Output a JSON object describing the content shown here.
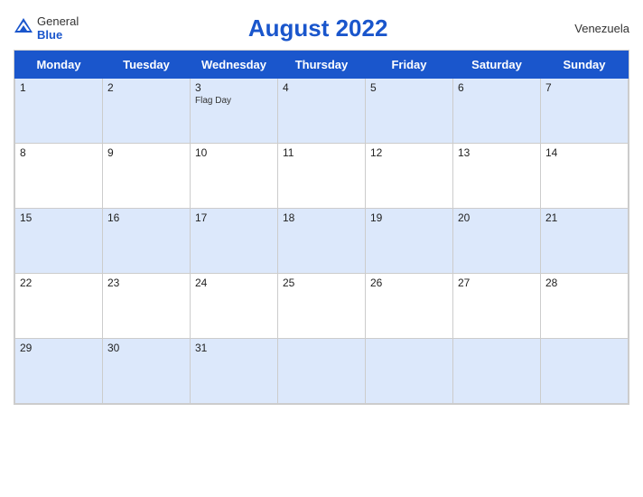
{
  "header": {
    "logo": {
      "general": "General",
      "blue": "Blue",
      "icon": "▲"
    },
    "title": "August 2022",
    "country": "Venezuela"
  },
  "weekdays": [
    "Monday",
    "Tuesday",
    "Wednesday",
    "Thursday",
    "Friday",
    "Saturday",
    "Sunday"
  ],
  "weeks": [
    [
      {
        "day": "1",
        "holiday": ""
      },
      {
        "day": "2",
        "holiday": ""
      },
      {
        "day": "3",
        "holiday": "Flag Day"
      },
      {
        "day": "4",
        "holiday": ""
      },
      {
        "day": "5",
        "holiday": ""
      },
      {
        "day": "6",
        "holiday": ""
      },
      {
        "day": "7",
        "holiday": ""
      }
    ],
    [
      {
        "day": "8",
        "holiday": ""
      },
      {
        "day": "9",
        "holiday": ""
      },
      {
        "day": "10",
        "holiday": ""
      },
      {
        "day": "11",
        "holiday": ""
      },
      {
        "day": "12",
        "holiday": ""
      },
      {
        "day": "13",
        "holiday": ""
      },
      {
        "day": "14",
        "holiday": ""
      }
    ],
    [
      {
        "day": "15",
        "holiday": ""
      },
      {
        "day": "16",
        "holiday": ""
      },
      {
        "day": "17",
        "holiday": ""
      },
      {
        "day": "18",
        "holiday": ""
      },
      {
        "day": "19",
        "holiday": ""
      },
      {
        "day": "20",
        "holiday": ""
      },
      {
        "day": "21",
        "holiday": ""
      }
    ],
    [
      {
        "day": "22",
        "holiday": ""
      },
      {
        "day": "23",
        "holiday": ""
      },
      {
        "day": "24",
        "holiday": ""
      },
      {
        "day": "25",
        "holiday": ""
      },
      {
        "day": "26",
        "holiday": ""
      },
      {
        "day": "27",
        "holiday": ""
      },
      {
        "day": "28",
        "holiday": ""
      }
    ],
    [
      {
        "day": "29",
        "holiday": ""
      },
      {
        "day": "30",
        "holiday": ""
      },
      {
        "day": "31",
        "holiday": ""
      },
      {
        "day": "",
        "holiday": ""
      },
      {
        "day": "",
        "holiday": ""
      },
      {
        "day": "",
        "holiday": ""
      },
      {
        "day": "",
        "holiday": ""
      }
    ]
  ],
  "colors": {
    "header_bg": "#1a56cc",
    "odd_row_bg": "#dce8fb",
    "even_row_bg": "#ffffff"
  }
}
